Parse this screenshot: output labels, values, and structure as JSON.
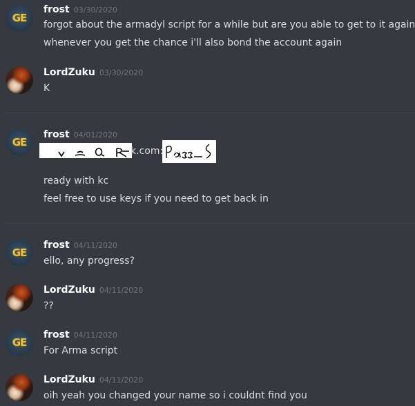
{
  "messages": [
    {
      "author": "frost",
      "timestamp": "03/30/2020",
      "avatar": "frost-ge-icon",
      "lines": [
        "forgot about the armadyl script for a while but are you able to get to it again?",
        "whenever you get the chance i'll also bond the account again"
      ]
    },
    {
      "author": "LordZuku",
      "timestamp": "03/30/2020",
      "avatar": "lordzuku-portrait",
      "lines": [
        "K"
      ]
    },
    {
      "author": "frost",
      "timestamp": "04/01/2020",
      "avatar": "frost-ge-icon",
      "credential_visible": "k.com:",
      "lines": [
        "ready with kc",
        "feel free to use keys if you need to get back in"
      ]
    },
    {
      "author": "frost",
      "timestamp": "04/11/2020",
      "avatar": "frost-ge-icon",
      "lines": [
        "ello, any progress?"
      ]
    },
    {
      "author": "LordZuku",
      "timestamp": "04/11/2020",
      "avatar": "lordzuku-portrait",
      "lines": [
        "??"
      ]
    },
    {
      "author": "frost",
      "timestamp": "04/11/2020",
      "avatar": "frost-ge-icon",
      "lines": [
        "For Arma script"
      ]
    },
    {
      "author": "LordZuku",
      "timestamp": "04/11/2020",
      "avatar": "lordzuku-portrait",
      "lines": [
        "oih yeah you changed your name so i couldnt find you"
      ]
    }
  ],
  "avatar_badge": "GE"
}
